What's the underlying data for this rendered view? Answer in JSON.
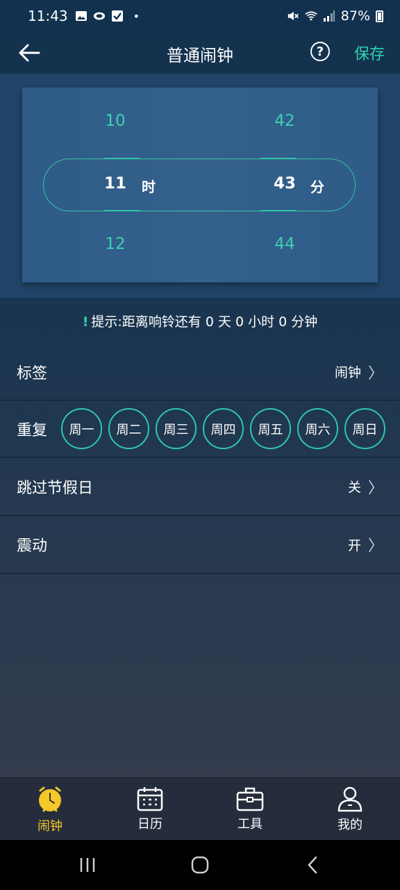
{
  "status": {
    "time": "11:43",
    "dot": "•",
    "battery": "87%",
    "icons_left": [
      "image-icon",
      "cloud-icon",
      "check-icon"
    ],
    "icons_right": [
      "mute-icon",
      "wifi-icon",
      "signal-icon",
      "battery-icon"
    ]
  },
  "appbar": {
    "title": "普通闹钟",
    "save": "保存",
    "help": "?"
  },
  "picker": {
    "hours": {
      "prev": "10",
      "selected": "11",
      "next": "12",
      "unit": "时"
    },
    "minutes": {
      "prev": "42",
      "selected": "43",
      "next": "44",
      "unit": "分"
    }
  },
  "hint": {
    "icon": "!",
    "text": "提示:距离响铃还有 0 天 0 小时 0 分钟"
  },
  "rows": {
    "label": {
      "label": "标签",
      "value": "闹钟"
    },
    "repeat": {
      "label": "重复",
      "days": [
        "周一",
        "周二",
        "周三",
        "周四",
        "周五",
        "周六",
        "周日"
      ]
    },
    "skip_holidays": {
      "label": "跳过节假日",
      "value": "关"
    },
    "vibrate": {
      "label": "震动",
      "value": "开"
    },
    "chevron": "〉"
  },
  "tabs": [
    {
      "label": "闹钟",
      "icon": "alarm-clock-icon",
      "active": true
    },
    {
      "label": "日历",
      "icon": "calendar-icon",
      "active": false
    },
    {
      "label": "工具",
      "icon": "toolbox-icon",
      "active": false
    },
    {
      "label": "我的",
      "icon": "person-icon",
      "active": false
    }
  ],
  "colors": {
    "accent": "#2fd4b0",
    "active_tab": "#f4c829",
    "picker_bg": "#214468"
  }
}
